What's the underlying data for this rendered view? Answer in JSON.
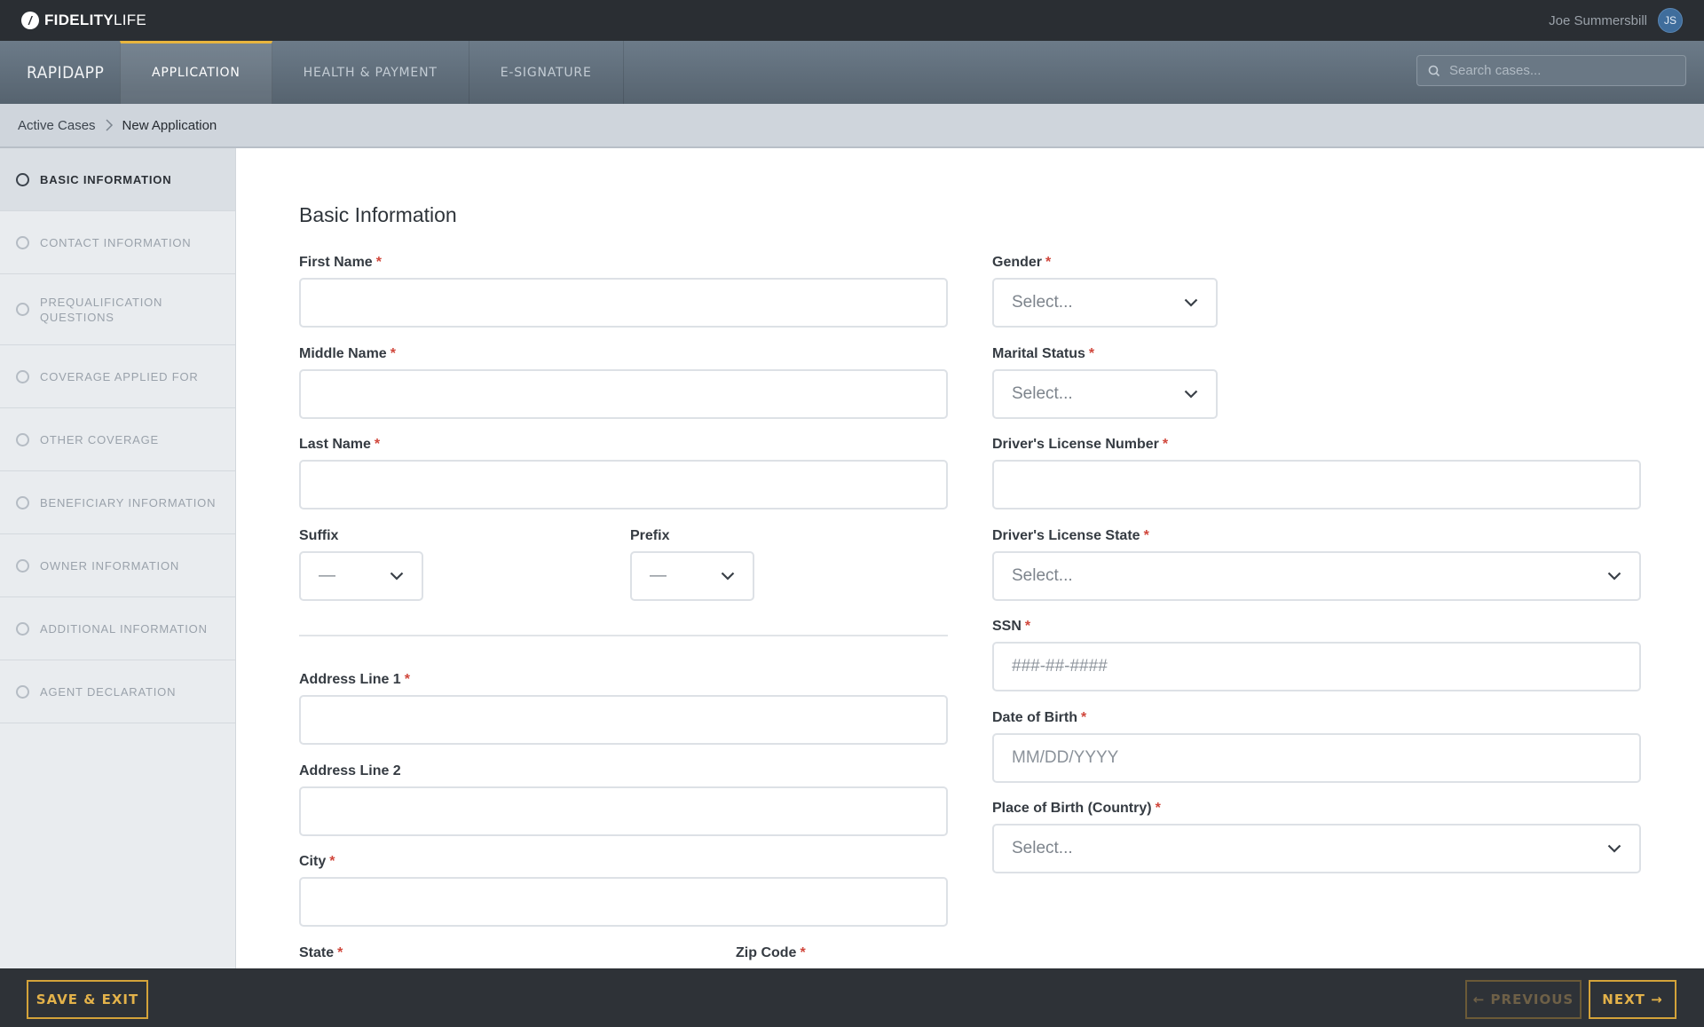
{
  "topbar": {
    "logo_bold": "FIDELITY",
    "logo_light": "LIFE",
    "user_name": "Joe Summersbill",
    "user_initials": "JS"
  },
  "navbar": {
    "brand": "RAPIDAPP",
    "tabs": [
      {
        "label": "APPLICATION",
        "active": true
      },
      {
        "label": "HEALTH & PAYMENT",
        "active": false
      },
      {
        "label": "E-SIGNATURE",
        "active": false
      }
    ],
    "search_placeholder": "Search cases..."
  },
  "breadcrumb": {
    "parent": "Active Cases",
    "current": "New Application"
  },
  "sidebar": {
    "items": [
      {
        "label": "BASIC INFORMATION",
        "active": true
      },
      {
        "label": "CONTACT INFORMATION",
        "active": false
      },
      {
        "label": "PREQUALIFICATION QUESTIONS",
        "active": false
      },
      {
        "label": "COVERAGE APPLIED FOR",
        "active": false
      },
      {
        "label": "OTHER COVERAGE",
        "active": false
      },
      {
        "label": "BENEFICIARY INFORMATION",
        "active": false
      },
      {
        "label": "OWNER INFORMATION",
        "active": false
      },
      {
        "label": "ADDITIONAL INFORMATION",
        "active": false
      },
      {
        "label": "AGENT DECLARATION",
        "active": false
      }
    ]
  },
  "form": {
    "title": "Basic Information",
    "required_mark": "*",
    "first_name_label": "First Name",
    "middle_name_label": "Middle Name",
    "last_name_label": "Last Name",
    "suffix_label": "Suffix",
    "suffix_value": "—",
    "prefix_label": "Prefix",
    "prefix_value": "—",
    "address1_label": "Address Line 1",
    "address2_label": "Address Line 2",
    "city_label": "City",
    "state_label": "State",
    "zip_label": "Zip Code",
    "gender_label": "Gender",
    "gender_value": "Select...",
    "marital_label": "Marital Status",
    "marital_value": "Select...",
    "dl_number_label": "Driver's License Number",
    "dl_state_label": "Driver's License State",
    "dl_state_value": "Select...",
    "ssn_label": "SSN",
    "ssn_placeholder": "###-##-####",
    "dob_label": "Date of Birth",
    "dob_placeholder": "MM/DD/YYYY",
    "pob_label": "Place of Birth (Country)",
    "pob_value": "Select..."
  },
  "footer": {
    "save_exit": "SAVE & EXIT",
    "previous": "← PREVIOUS",
    "next": "NEXT →"
  },
  "colors": {
    "accent": "#e3b24a",
    "required": "#d0463b",
    "topbar": "#2a2e33",
    "nav_gradient_top": "#6c7b89"
  }
}
